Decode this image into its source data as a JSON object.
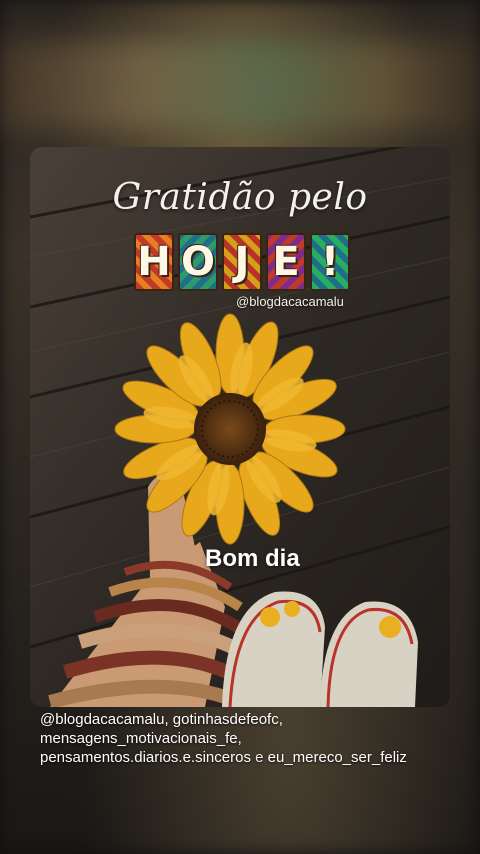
{
  "post": {
    "title_line1": "Gratidão pelo",
    "title_letters": [
      "H",
      "O",
      "J",
      "E",
      "!"
    ],
    "handle": "@blogdacacamalu",
    "greeting": "Bom dia"
  },
  "caption": {
    "line1": "@blogdacacamalu, gotinhasdefeofc,",
    "line2": "mensagens_motivacionais_fe,",
    "line3_a": "pensamentos.diarios.e.sinceros",
    "line3_conj": "e",
    "line3_b": "eu_mereco_ser_feliz"
  },
  "colors": {
    "petal": "#e8a81c",
    "flower_center": "#5a3312",
    "wood": "#3a332c"
  }
}
